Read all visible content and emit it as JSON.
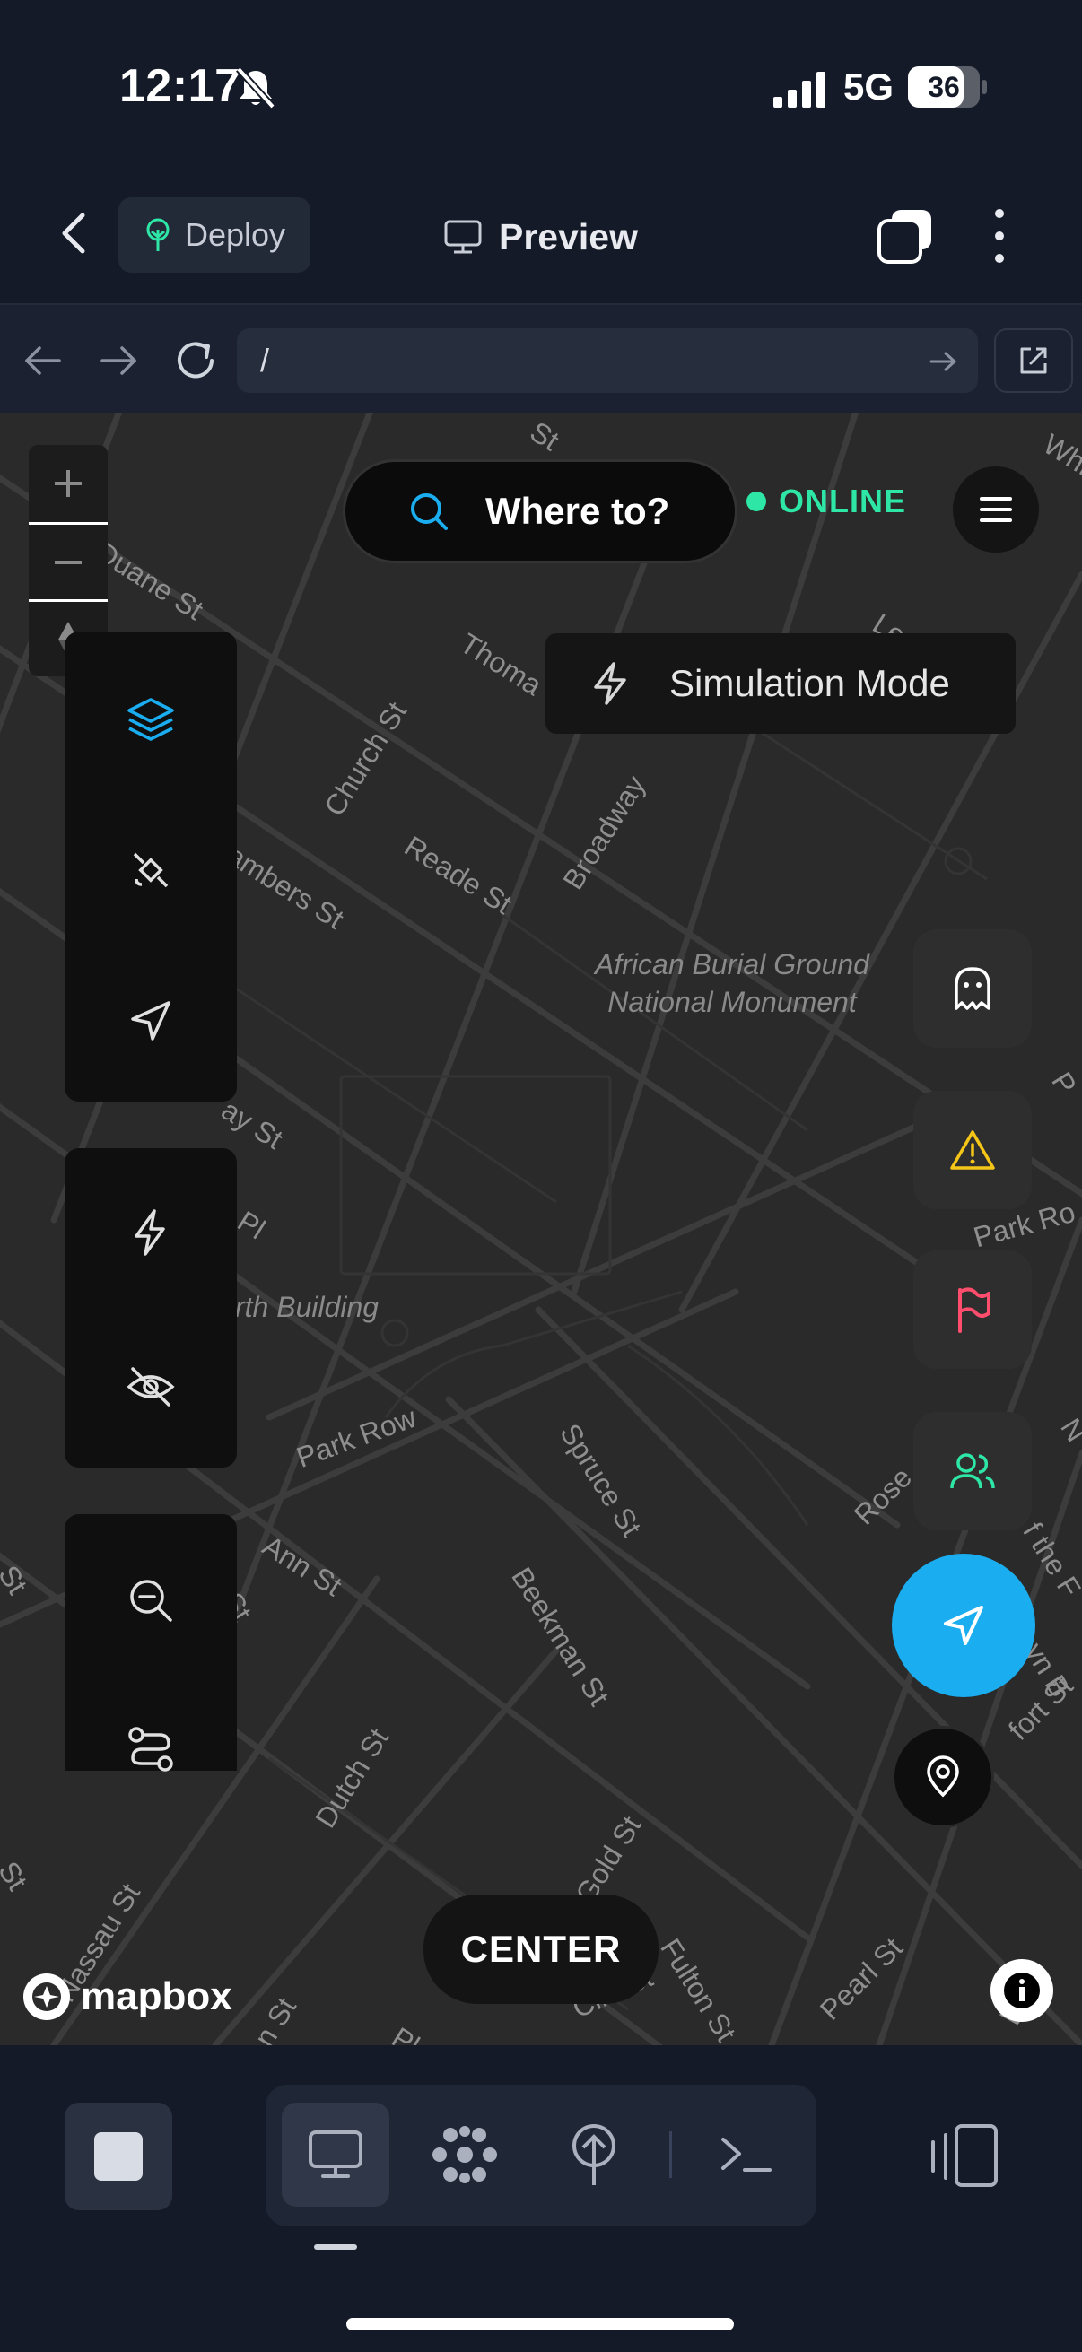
{
  "status_bar": {
    "time": "12:17",
    "network": "5G",
    "battery": "36",
    "icons": [
      "bell-off-icon",
      "signal-icon",
      "battery-icon"
    ]
  },
  "app_bar": {
    "deploy_label": "Deploy",
    "preview_label": "Preview",
    "icons": [
      "chevron-left-icon",
      "tree-icon",
      "monitor-icon",
      "tabs-icon",
      "more-vertical-icon"
    ]
  },
  "url_bar": {
    "url": "/",
    "icons": [
      "arrow-left-icon",
      "arrow-right-icon",
      "reload-icon",
      "arrow-right-small-icon",
      "external-link-icon"
    ]
  },
  "map": {
    "search_label": "Where to?",
    "status_label": "ONLINE",
    "simulation_label": "Simulation Mode",
    "center_label": "CENTER",
    "attribution": "mapbox",
    "streets": [
      "Duane St",
      "Thomas St",
      "Church St",
      "Reade St",
      "Broadway",
      "Chambers St",
      "Murray St",
      "Park Row",
      "Spruce St",
      "Ann St",
      "Beekman St",
      "Dutch St",
      "Gold St",
      "Nassau St",
      "Fulton St",
      "Pearl St",
      "Cliff St",
      "Rose St"
    ],
    "street_fragments": {
      "duane": "Duane St",
      "thomas": "Thoma",
      "church": "Church St",
      "reade": "Reade St",
      "broadway": "Broadway",
      "chambers": "ambers St",
      "murray": "ay St",
      "parkrow": "Park Row",
      "spruce": "Spruce St",
      "ann": "Ann St",
      "beekman": "Beekman St",
      "dutch": "Dutch St",
      "gold": "Gold St",
      "nassau": "Nassau St",
      "fulton": "Fulton St",
      "pearl": "Pearl St",
      "cliff": "Cliff St",
      "rose": "Rose",
      "parkro_right": "Park Ro",
      "st_left1": "St",
      "st_left2": "St",
      "st_top": "St",
      "st_ann": "St",
      "pl": "Pl",
      "wa": "Wa",
      "le": "Le",
      "pl2": "Pla",
      "st_bottom": "n St",
      "p_right": "P",
      "m_right": "N",
      "white": "White",
      "fthe": "f the F",
      "yn": "yn B",
      "ford": "fort St"
    },
    "poi": {
      "burial_line1": "African Burial Ground",
      "burial_line2": "National Monument",
      "building": "rth Building"
    },
    "left_tools": [
      "layers-icon",
      "satellite-icon",
      "navigation-icon",
      "lightning-icon",
      "eye-off-icon",
      "zoom-out-icon",
      "route-icon"
    ],
    "right_tools": [
      "ghost-icon",
      "alert-icon",
      "flag-icon",
      "users-icon"
    ],
    "colors": {
      "accent_blue": "#1aaef0",
      "online_green": "#2ee6a6",
      "warning_yellow": "#f5c518",
      "flag_red": "#ff4d6d",
      "users_green": "#2ee6a6"
    }
  },
  "bottom_bar": {
    "icons": [
      "stop-icon",
      "monitor-icon",
      "flower-icon",
      "deploy-icon",
      "terminal-icon",
      "devices-icon"
    ]
  }
}
